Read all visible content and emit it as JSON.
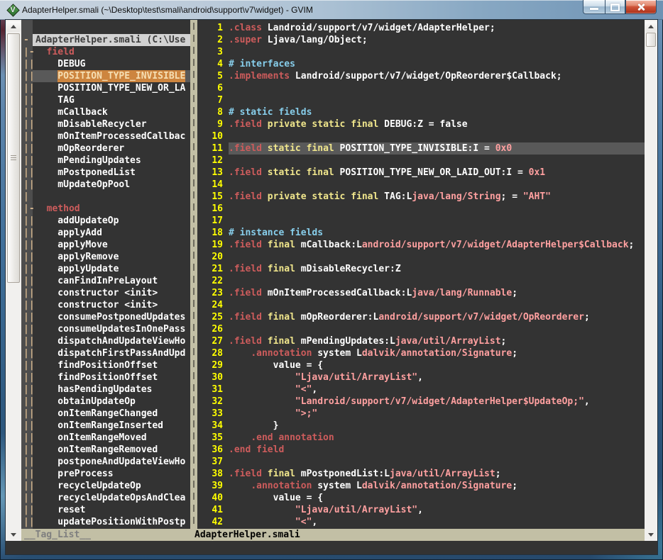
{
  "window": {
    "title": "AdapterHelper.smali (~\\Desktop\\test\\smali\\android\\support\\v7\\widget) - GVIM",
    "controls": {
      "minimize": "minimize",
      "maximize": "maximize",
      "close": "close"
    }
  },
  "colors": {
    "editor_background": "#333333",
    "line_number": "#ffff00",
    "directive": "#cd5c5c",
    "keyword": "#f0e68c",
    "comment": "#87ceeb",
    "constant": "#ffa0a0",
    "normal_text": "#ffffff",
    "status_bar": "#c2bfa5",
    "fold_column_bg": "#4d4d4d",
    "fold_marker": "#d2b48c",
    "cursor_line": "#595959",
    "tag_highlight_bg": "#cd853f",
    "tag_highlight_fg": "#f5deb3",
    "file_header_bg": "#d2d2d2"
  },
  "taglist": {
    "rows": [
      {
        "fold": "-",
        "text": "AdapterHelper.smali (C:\\Use",
        "type": "header",
        "ind": 0
      },
      {
        "fold": "|-",
        "text": "field",
        "type": "section",
        "ind": 2
      },
      {
        "fold": "||",
        "text": "DEBUG",
        "type": "item",
        "ind": 4
      },
      {
        "fold": "||",
        "text": "POSITION_TYPE_INVISIBLE",
        "type": "active",
        "ind": 4
      },
      {
        "fold": "||",
        "text": "POSITION_TYPE_NEW_OR_LA",
        "type": "item",
        "ind": 4
      },
      {
        "fold": "||",
        "text": "TAG",
        "type": "item",
        "ind": 4
      },
      {
        "fold": "||",
        "text": "mCallback",
        "type": "item",
        "ind": 4
      },
      {
        "fold": "||",
        "text": "mDisableRecycler",
        "type": "item",
        "ind": 4
      },
      {
        "fold": "||",
        "text": "mOnItemProcessedCallbac",
        "type": "item",
        "ind": 4
      },
      {
        "fold": "||",
        "text": "mOpReorderer",
        "type": "item",
        "ind": 4
      },
      {
        "fold": "||",
        "text": "mPendingUpdates",
        "type": "item",
        "ind": 4
      },
      {
        "fold": "||",
        "text": "mPostponedList",
        "type": "item",
        "ind": 4
      },
      {
        "fold": "||",
        "text": "mUpdateOpPool",
        "type": "item",
        "ind": 4
      },
      {
        "fold": "|",
        "text": "",
        "type": "blank",
        "ind": 0
      },
      {
        "fold": "|-",
        "text": "method",
        "type": "section",
        "ind": 2
      },
      {
        "fold": "||",
        "text": "addUpdateOp",
        "type": "item",
        "ind": 4
      },
      {
        "fold": "||",
        "text": "applyAdd",
        "type": "item",
        "ind": 4
      },
      {
        "fold": "||",
        "text": "applyMove",
        "type": "item",
        "ind": 4
      },
      {
        "fold": "||",
        "text": "applyRemove",
        "type": "item",
        "ind": 4
      },
      {
        "fold": "||",
        "text": "applyUpdate",
        "type": "item",
        "ind": 4
      },
      {
        "fold": "||",
        "text": "canFindInPreLayout",
        "type": "item",
        "ind": 4
      },
      {
        "fold": "||",
        "text": "constructor <init>",
        "type": "item",
        "ind": 4
      },
      {
        "fold": "||",
        "text": "constructor <init>",
        "type": "item",
        "ind": 4
      },
      {
        "fold": "||",
        "text": "consumePostponedUpdates",
        "type": "item",
        "ind": 4
      },
      {
        "fold": "||",
        "text": "consumeUpdatesInOnePass",
        "type": "item",
        "ind": 4
      },
      {
        "fold": "||",
        "text": "dispatchAndUpdateViewHo",
        "type": "item",
        "ind": 4
      },
      {
        "fold": "||",
        "text": "dispatchFirstPassAndUpd",
        "type": "item",
        "ind": 4
      },
      {
        "fold": "||",
        "text": "findPositionOffset",
        "type": "item",
        "ind": 4
      },
      {
        "fold": "||",
        "text": "findPositionOffset",
        "type": "item",
        "ind": 4
      },
      {
        "fold": "||",
        "text": "hasPendingUpdates",
        "type": "item",
        "ind": 4
      },
      {
        "fold": "||",
        "text": "obtainUpdateOp",
        "type": "item",
        "ind": 4
      },
      {
        "fold": "||",
        "text": "onItemRangeChanged",
        "type": "item",
        "ind": 4
      },
      {
        "fold": "||",
        "text": "onItemRangeInserted",
        "type": "item",
        "ind": 4
      },
      {
        "fold": "||",
        "text": "onItemRangeMoved",
        "type": "item",
        "ind": 4
      },
      {
        "fold": "||",
        "text": "onItemRangeRemoved",
        "type": "item",
        "ind": 4
      },
      {
        "fold": "||",
        "text": "postponeAndUpdateViewHo",
        "type": "item",
        "ind": 4
      },
      {
        "fold": "||",
        "text": "preProcess",
        "type": "item",
        "ind": 4
      },
      {
        "fold": "||",
        "text": "recycleUpdateOp",
        "type": "item",
        "ind": 4
      },
      {
        "fold": "||",
        "text": "recycleUpdateOpsAndClea",
        "type": "item",
        "ind": 4
      },
      {
        "fold": "||",
        "text": "reset",
        "type": "item",
        "ind": 4
      },
      {
        "fold": "||",
        "text": "updatePositionWithPostp",
        "type": "item",
        "ind": 4
      }
    ]
  },
  "editor": {
    "lines": [
      {
        "n": 1,
        "seg": [
          [
            "r",
            ".class"
          ],
          [
            "w",
            " Landroid/support/v7/widget/AdapterHelper;"
          ]
        ]
      },
      {
        "n": 2,
        "seg": [
          [
            "r",
            ".super"
          ],
          [
            "w",
            " Ljava/lang/Object;"
          ]
        ]
      },
      {
        "n": 3,
        "seg": []
      },
      {
        "n": 4,
        "seg": [
          [
            "c",
            "# interfaces"
          ]
        ]
      },
      {
        "n": 5,
        "seg": [
          [
            "r",
            ".implements"
          ],
          [
            "w",
            " Landroid/support/v7/widget/OpReorderer$Callback;"
          ]
        ]
      },
      {
        "n": 6,
        "seg": []
      },
      {
        "n": 7,
        "seg": []
      },
      {
        "n": 8,
        "seg": [
          [
            "c",
            "# static fields"
          ]
        ]
      },
      {
        "n": 9,
        "seg": [
          [
            "r",
            ".field"
          ],
          [
            "w",
            " "
          ],
          [
            "k",
            "private static final"
          ],
          [
            "w",
            " DEBUG:Z = false"
          ]
        ]
      },
      {
        "n": 10,
        "seg": []
      },
      {
        "n": 11,
        "cur": true,
        "seg": [
          [
            "r",
            ".field"
          ],
          [
            "w",
            " "
          ],
          [
            "k",
            "static final"
          ],
          [
            "w",
            " POSITION_TYPE_INVISIBLE:I = "
          ],
          [
            "p",
            "0x0"
          ]
        ]
      },
      {
        "n": 12,
        "seg": []
      },
      {
        "n": 13,
        "seg": [
          [
            "r",
            ".field"
          ],
          [
            "w",
            " "
          ],
          [
            "k",
            "static final"
          ],
          [
            "w",
            " POSITION_TYPE_NEW_OR_LAID_OUT:I = "
          ],
          [
            "p",
            "0x1"
          ]
        ]
      },
      {
        "n": 14,
        "seg": []
      },
      {
        "n": 15,
        "seg": [
          [
            "r",
            ".field"
          ],
          [
            "w",
            " "
          ],
          [
            "k",
            "private static final"
          ],
          [
            "w",
            " TAG:L"
          ],
          [
            "p",
            "java/lang/String"
          ],
          [
            "w",
            "; = "
          ],
          [
            "p",
            "\"AHT\""
          ]
        ]
      },
      {
        "n": 16,
        "seg": []
      },
      {
        "n": 17,
        "seg": []
      },
      {
        "n": 18,
        "seg": [
          [
            "c",
            "# instance fields"
          ]
        ]
      },
      {
        "n": 19,
        "seg": [
          [
            "r",
            ".field"
          ],
          [
            "w",
            " "
          ],
          [
            "k",
            "final"
          ],
          [
            "w",
            " mCallback:L"
          ],
          [
            "p",
            "android/support/v7/widget/AdapterHelper$Callback"
          ],
          [
            "w",
            ";"
          ]
        ]
      },
      {
        "n": 20,
        "seg": []
      },
      {
        "n": 21,
        "seg": [
          [
            "r",
            ".field"
          ],
          [
            "w",
            " "
          ],
          [
            "k",
            "final"
          ],
          [
            "w",
            " mDisableRecycler:Z"
          ]
        ]
      },
      {
        "n": 22,
        "seg": []
      },
      {
        "n": 23,
        "seg": [
          [
            "r",
            ".field"
          ],
          [
            "w",
            " mOnItemProcessedCallback:L"
          ],
          [
            "p",
            "java/lang/Runnable"
          ],
          [
            "w",
            ";"
          ]
        ]
      },
      {
        "n": 24,
        "seg": []
      },
      {
        "n": 25,
        "seg": [
          [
            "r",
            ".field"
          ],
          [
            "w",
            " "
          ],
          [
            "k",
            "final"
          ],
          [
            "w",
            " mOpReorderer:L"
          ],
          [
            "p",
            "android/support/v7/widget/OpReorderer"
          ],
          [
            "w",
            ";"
          ]
        ]
      },
      {
        "n": 26,
        "seg": []
      },
      {
        "n": 27,
        "seg": [
          [
            "r",
            ".field"
          ],
          [
            "w",
            " "
          ],
          [
            "k",
            "final"
          ],
          [
            "w",
            " mPendingUpdates:L"
          ],
          [
            "p",
            "java/util/ArrayList"
          ],
          [
            "w",
            ";"
          ]
        ]
      },
      {
        "n": 28,
        "seg": [
          [
            "w",
            "    "
          ],
          [
            "r",
            ".annotation"
          ],
          [
            "w",
            " system L"
          ],
          [
            "p",
            "dalvik/annotation/Signature"
          ],
          [
            "w",
            ";"
          ]
        ]
      },
      {
        "n": 29,
        "seg": [
          [
            "w",
            "        value = {"
          ]
        ]
      },
      {
        "n": 30,
        "seg": [
          [
            "w",
            "            "
          ],
          [
            "p",
            "\"Ljava/util/ArrayList\""
          ],
          [
            "w",
            ","
          ]
        ]
      },
      {
        "n": 31,
        "seg": [
          [
            "w",
            "            "
          ],
          [
            "p",
            "\"<\""
          ],
          [
            "w",
            ","
          ]
        ]
      },
      {
        "n": 32,
        "seg": [
          [
            "w",
            "            "
          ],
          [
            "p",
            "\"Landroid/support/v7/widget/AdapterHelper$UpdateOp;\""
          ],
          [
            "w",
            ","
          ]
        ]
      },
      {
        "n": 33,
        "seg": [
          [
            "w",
            "            "
          ],
          [
            "p",
            "\">;\""
          ]
        ]
      },
      {
        "n": 34,
        "seg": [
          [
            "w",
            "        }"
          ]
        ]
      },
      {
        "n": 35,
        "seg": [
          [
            "w",
            "    "
          ],
          [
            "r",
            ".end annotation"
          ]
        ]
      },
      {
        "n": 36,
        "seg": [
          [
            "r",
            ".end field"
          ]
        ]
      },
      {
        "n": 37,
        "seg": []
      },
      {
        "n": 38,
        "seg": [
          [
            "r",
            ".field"
          ],
          [
            "w",
            " "
          ],
          [
            "k",
            "final"
          ],
          [
            "w",
            " mPostponedList:L"
          ],
          [
            "p",
            "java/util/ArrayList"
          ],
          [
            "w",
            ";"
          ]
        ]
      },
      {
        "n": 39,
        "seg": [
          [
            "w",
            "    "
          ],
          [
            "r",
            ".annotation"
          ],
          [
            "w",
            " system L"
          ],
          [
            "p",
            "dalvik/annotation/Signature"
          ],
          [
            "w",
            ";"
          ]
        ]
      },
      {
        "n": 40,
        "seg": [
          [
            "w",
            "        value = {"
          ]
        ]
      },
      {
        "n": 41,
        "seg": [
          [
            "w",
            "            "
          ],
          [
            "p",
            "\"Ljava/util/ArrayList\""
          ],
          [
            "w",
            ","
          ]
        ]
      },
      {
        "n": 42,
        "seg": [
          [
            "w",
            "            "
          ],
          [
            "p",
            "\"<\""
          ],
          [
            "w",
            ","
          ]
        ]
      }
    ]
  },
  "statusbar": {
    "window_name": "__Tag_List__",
    "file_name": "AdapterHelper.smali"
  }
}
